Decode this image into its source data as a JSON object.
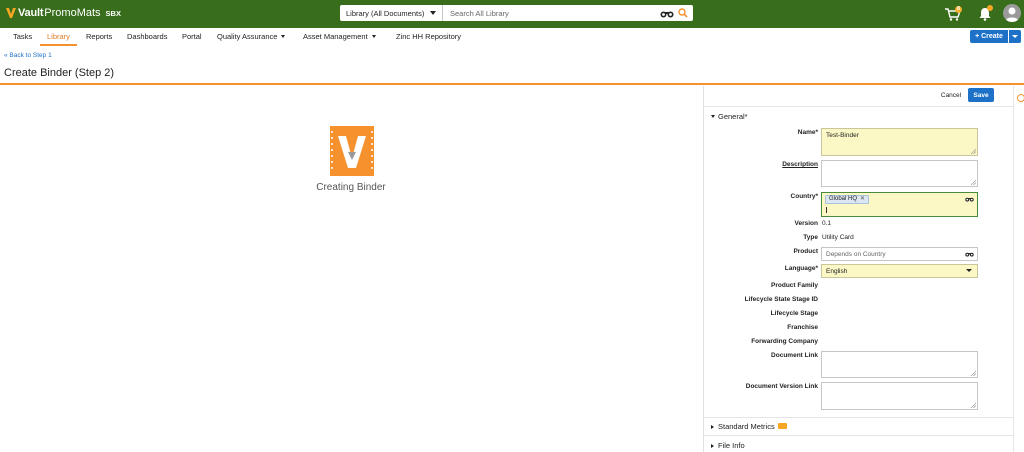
{
  "brand": {
    "name": "Vault",
    "product": "PromoMats",
    "env": "SBX"
  },
  "search": {
    "scope": "Library (All Documents)",
    "placeholder": "Search All Library"
  },
  "header": {
    "cart_count": "8"
  },
  "nav": {
    "items": [
      "Tasks",
      "Library",
      "Reports",
      "Dashboards",
      "Portal",
      "Quality Assurance",
      "Asset Management",
      "Zinc HH Repository"
    ],
    "active": "Library",
    "create_label": "+ Create"
  },
  "page": {
    "back_link": "« Back to Step 1",
    "title": "Create Binder (Step 2)",
    "status_text": "Creating Binder"
  },
  "panel": {
    "cancel_label": "Cancel",
    "save_label": "Save",
    "section_general": "General*",
    "section_metrics": "Standard Metrics",
    "section_fileinfo": "File Info",
    "fields": {
      "name_label": "Name*",
      "name_value": "Test-Binder",
      "description_label": "Description",
      "country_label": "Country*",
      "country_chip": "Global HQ",
      "version_label": "Version",
      "version_value": "0.1",
      "type_label": "Type",
      "type_value": "Utility Card",
      "product_label": "Product",
      "product_placeholder": "Depends on Country",
      "language_label": "Language*",
      "language_value": "English",
      "product_family_label": "Product Family",
      "lifecycle_state_stage_id_label": "Lifecycle State Stage ID",
      "lifecycle_stage_label": "Lifecycle Stage",
      "franchise_label": "Franchise",
      "forwarding_company_label": "Forwarding Company",
      "document_link_label": "Document Link",
      "document_version_link_label": "Document Version Link"
    }
  },
  "colors": {
    "topbar": "#386d1c",
    "accent": "#f5922e",
    "primary": "#1d72c8",
    "required_bg": "#fbf8c6"
  },
  "icons": [
    "vault-logo-icon",
    "binoculars-icon",
    "search-icon",
    "cart-icon",
    "bell-icon",
    "avatar-icon",
    "vault-binder-icon",
    "email-icon",
    "help-icon"
  ]
}
